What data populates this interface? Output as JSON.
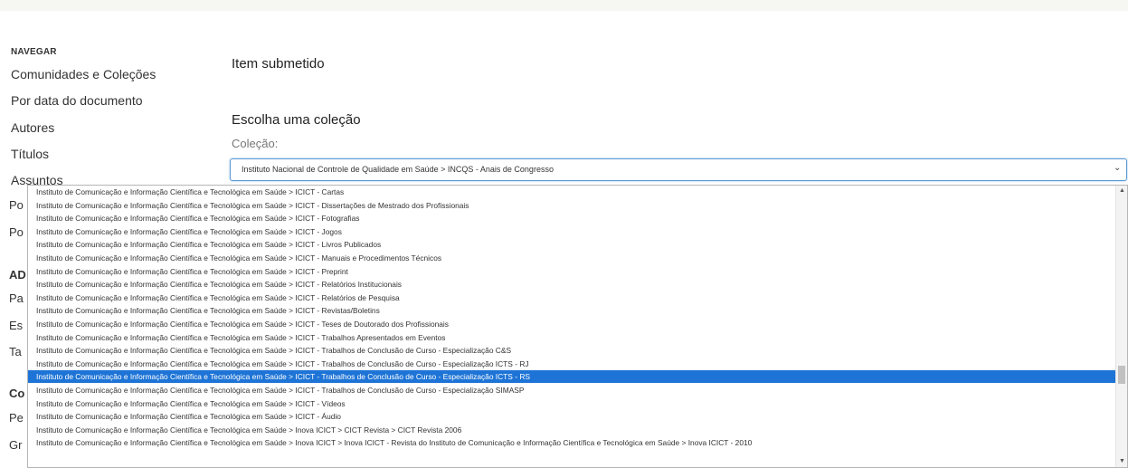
{
  "sidebar": {
    "heading": "NAVEGAR",
    "links": [
      "Comunidades e Coleções",
      "Por data do documento",
      "Autores",
      "Títulos",
      "Assuntos"
    ],
    "partials": [
      "Po",
      "Po",
      "AD",
      "Pa",
      "Es",
      "Ta",
      "Co",
      "Pe",
      "Gr"
    ]
  },
  "main": {
    "title": "Item submetido",
    "section_title": "Escolha uma coleção",
    "field_label": "Coleção:",
    "selected_value": "Instituto Nacional de Controle de Qualidade em Saúde > INCQS - Anais de Congresso"
  },
  "dropdown": {
    "selected_index": 14,
    "options": [
      "Instituto de Comunicação e Informação Científica e Tecnológica em Saúde > ICICT - Cartas",
      "Instituto de Comunicação e Informação Científica e Tecnológica em Saúde > ICICT - Dissertações de Mestrado dos Profissionais",
      "Instituto de Comunicação e Informação Científica e Tecnológica em Saúde > ICICT - Fotografias",
      "Instituto de Comunicação e Informação Científica e Tecnológica em Saúde > ICICT - Jogos",
      "Instituto de Comunicação e Informação Científica e Tecnológica em Saúde > ICICT - Livros Publicados",
      "Instituto de Comunicação e Informação Científica e Tecnológica em Saúde > ICICT - Manuais e Procedimentos Técnicos",
      "Instituto de Comunicação e Informação Científica e Tecnológica em Saúde > ICICT - Preprint",
      "Instituto de Comunicação e Informação Científica e Tecnológica em Saúde > ICICT - Relatórios Institucionais",
      "Instituto de Comunicação e Informação Científica e Tecnológica em Saúde > ICICT - Relatórios de Pesquisa",
      "Instituto de Comunicação e Informação Científica e Tecnológica em Saúde > ICICT - Revistas/Boletins",
      "Instituto de Comunicação e Informação Científica e Tecnológica em Saúde > ICICT - Teses de Doutorado dos Profissionais",
      "Instituto de Comunicação e Informação Científica e Tecnológica em Saúde > ICICT - Trabalhos Apresentados em Eventos",
      "Instituto de Comunicação e Informação Científica e Tecnológica em Saúde > ICICT - Trabalhos de Conclusão de Curso - Especialização C&S",
      "Instituto de Comunicação e Informação Científica e Tecnológica em Saúde > ICICT - Trabalhos de Conclusão de Curso - Especialização ICTS - RJ",
      "Instituto de Comunicação e Informação Científica e Tecnológica em Saúde > ICICT - Trabalhos de Conclusão de Curso - Especialização ICTS - RS",
      "Instituto de Comunicação e Informação Científica e Tecnológica em Saúde > ICICT - Trabalhos de Conclusão de Curso - Especialização SIMASP",
      "Instituto de Comunicação e Informação Científica e Tecnológica em Saúde > ICICT - Vídeos",
      "Instituto de Comunicação e Informação Científica e Tecnológica em Saúde > ICICT - Áudio",
      "Instituto de Comunicação e Informação Científica e Tecnológica em Saúde > Inova ICICT > CICT Revista > CICT Revista 2006",
      "Instituto de Comunicação e Informação Científica e Tecnológica em Saúde > Inova ICICT > Inova ICICT - Revista do Instituto de Comunicação e Informação Científica e Tecnológica em Saúde > Inova ICICT - 2010"
    ]
  },
  "colors": {
    "selected_bg": "#1e74d6",
    "select_border": "#5b9bd5"
  },
  "icons": {
    "chevron": "chevron-down-icon",
    "scroll_up": "scroll-up-icon",
    "scroll_down": "scroll-down-icon"
  }
}
